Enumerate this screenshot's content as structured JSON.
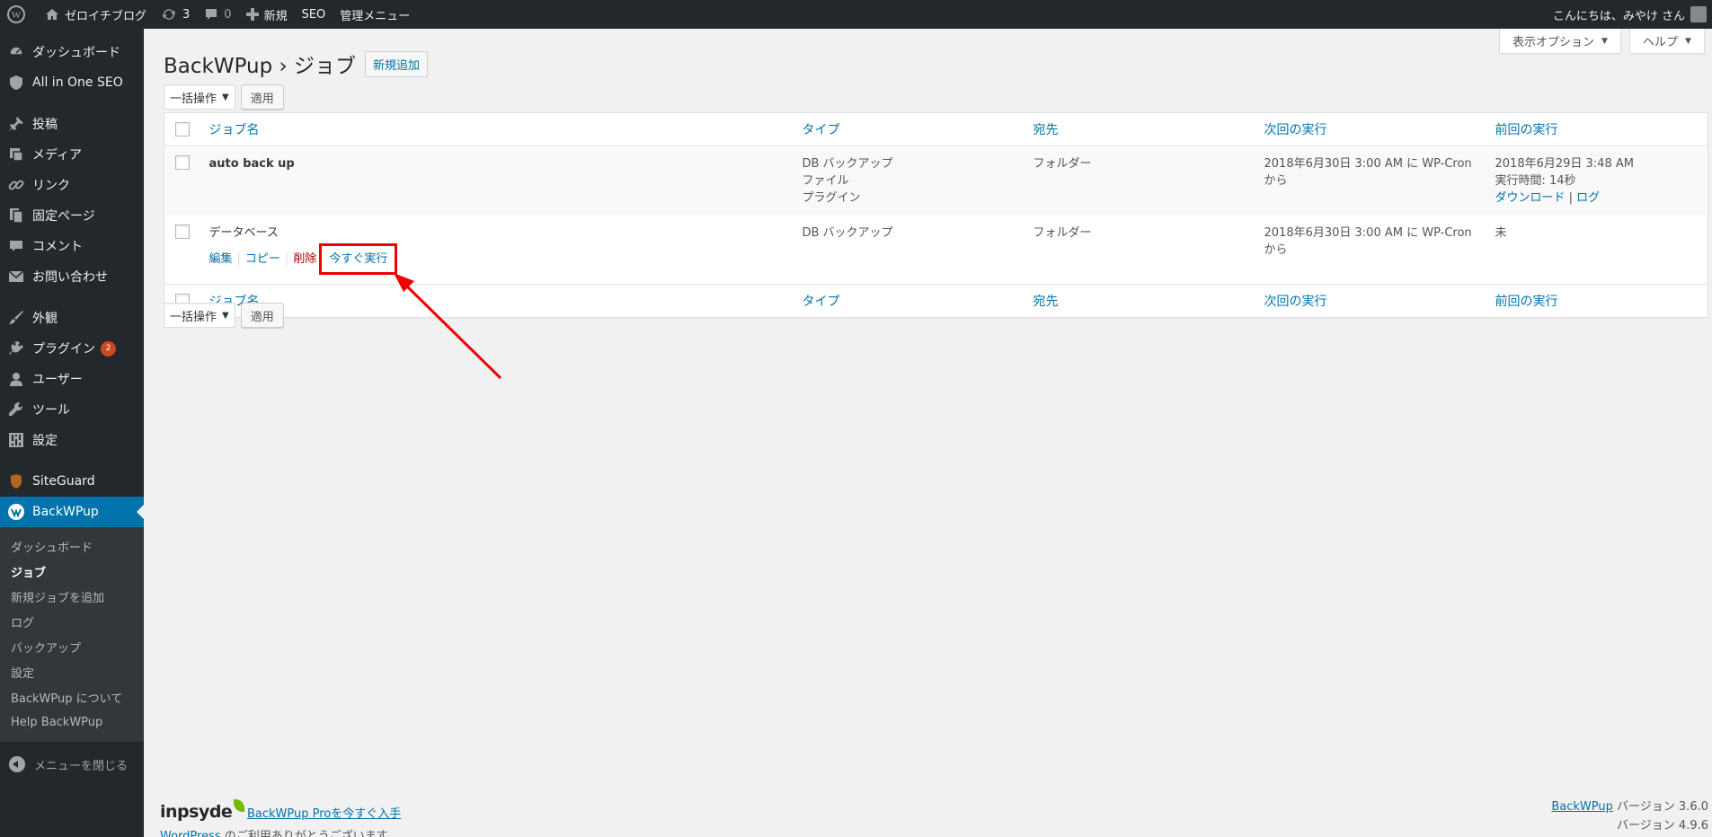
{
  "adminbar": {
    "site_name": "ゼロイチブログ",
    "updates_count": "3",
    "comments_count": "0",
    "new_label": "新規",
    "seo_label": "SEO",
    "admin_menu_label": "管理メニュー",
    "greeting": "こんにちは、みやけ さん"
  },
  "screen_meta": {
    "options_label": "表示オプション",
    "help_label": "ヘルプ"
  },
  "sidebar": {
    "items": [
      {
        "label": "ダッシュボード",
        "icon": "dashboard-icon"
      },
      {
        "label": "All in One SEO",
        "icon": "shield-icon"
      },
      {
        "label": "投稿",
        "icon": "pushpin-icon"
      },
      {
        "label": "メディア",
        "icon": "media-icon"
      },
      {
        "label": "リンク",
        "icon": "link-icon"
      },
      {
        "label": "固定ページ",
        "icon": "page-icon"
      },
      {
        "label": "コメント",
        "icon": "comment-icon"
      },
      {
        "label": "お問い合わせ",
        "icon": "mail-icon"
      },
      {
        "label": "外観",
        "icon": "brush-icon"
      },
      {
        "label": "プラグイン",
        "icon": "plugin-icon",
        "badge": "2"
      },
      {
        "label": "ユーザー",
        "icon": "user-icon"
      },
      {
        "label": "ツール",
        "icon": "wrench-icon"
      },
      {
        "label": "設定",
        "icon": "settings-icon"
      },
      {
        "label": "SiteGuard",
        "icon": "siteguard-icon"
      },
      {
        "label": "BackWPup",
        "icon": "backwpup-icon"
      }
    ],
    "submenu": [
      "ダッシュボード",
      "ジョブ",
      "新規ジョブを追加",
      "ログ",
      "バックアップ",
      "設定",
      "BackWPup について",
      "Help BackWPup"
    ],
    "collapse_label": "メニューを閉じる"
  },
  "page": {
    "title": "BackWPup › ジョブ",
    "add_new_label": "新規追加",
    "bulk_action_label": "一括操作",
    "apply_label": "適用"
  },
  "table": {
    "columns": [
      "ジョブ名",
      "タイプ",
      "宛先",
      "次回の実行",
      "前回の実行"
    ],
    "rows": [
      {
        "name": "auto back up",
        "type_lines": [
          "DB バックアップ",
          "ファイル",
          "プラグイン"
        ],
        "destination": "フォルダー",
        "next_run": "2018年6月30日 3:00 AM に WP-Cron から",
        "last_run_line1": "2018年6月29日 3:48 AM",
        "last_run_line2": "実行時間: 14秒",
        "last_run_download": "ダウンロード",
        "last_run_log": "ログ"
      },
      {
        "name": "データベース",
        "actions": {
          "edit": "編集",
          "copy": "コピー",
          "delete": "削除",
          "run_now": "今すぐ実行"
        },
        "type_lines": [
          "DB バックアップ"
        ],
        "destination": "フォルダー",
        "next_run": "2018年6月30日 3:00 AM に WP-Cron から",
        "last_run_line1": "未"
      }
    ]
  },
  "footer": {
    "inpsyde_logo": "inpsyde",
    "pro_link": "BackWPup Proを今すぐ入手",
    "thanks_link": "WordPress",
    "thanks_text": " のご利用ありがとうございます。",
    "version_link": "BackWPup",
    "version_text": " バージョン 3.6.0",
    "wp_version": "バージョン 4.9.6"
  },
  "colors": {
    "accent": "#0073aa",
    "sidebar_bg": "#23282d",
    "highlight_box": "#ee0000"
  }
}
